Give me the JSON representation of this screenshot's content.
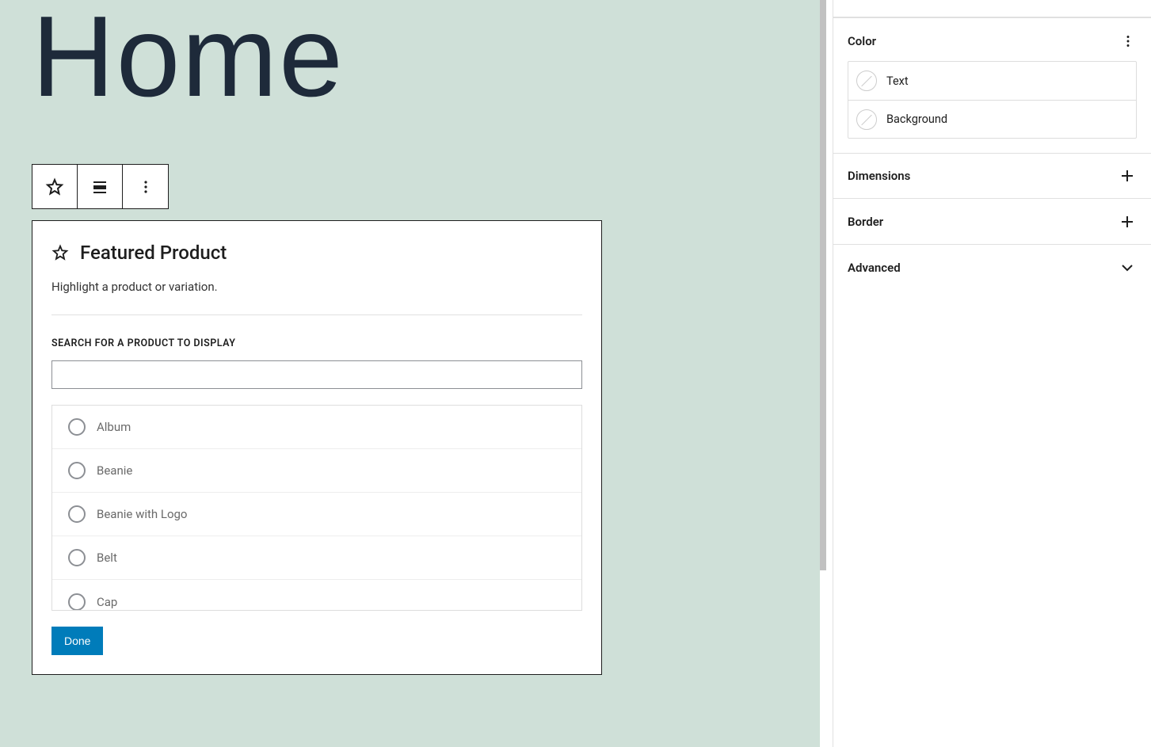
{
  "page": {
    "title": "Home"
  },
  "block": {
    "title": "Featured Product",
    "description": "Highlight a product or variation.",
    "search_label": "SEARCH FOR A PRODUCT TO DISPLAY",
    "done_label": "Done",
    "products": [
      "Album",
      "Beanie",
      "Beanie with Logo",
      "Belt",
      "Cap"
    ]
  },
  "sidebar": {
    "color": {
      "title": "Color",
      "text_label": "Text",
      "background_label": "Background"
    },
    "dimensions": "Dimensions",
    "border": "Border",
    "advanced": "Advanced"
  }
}
